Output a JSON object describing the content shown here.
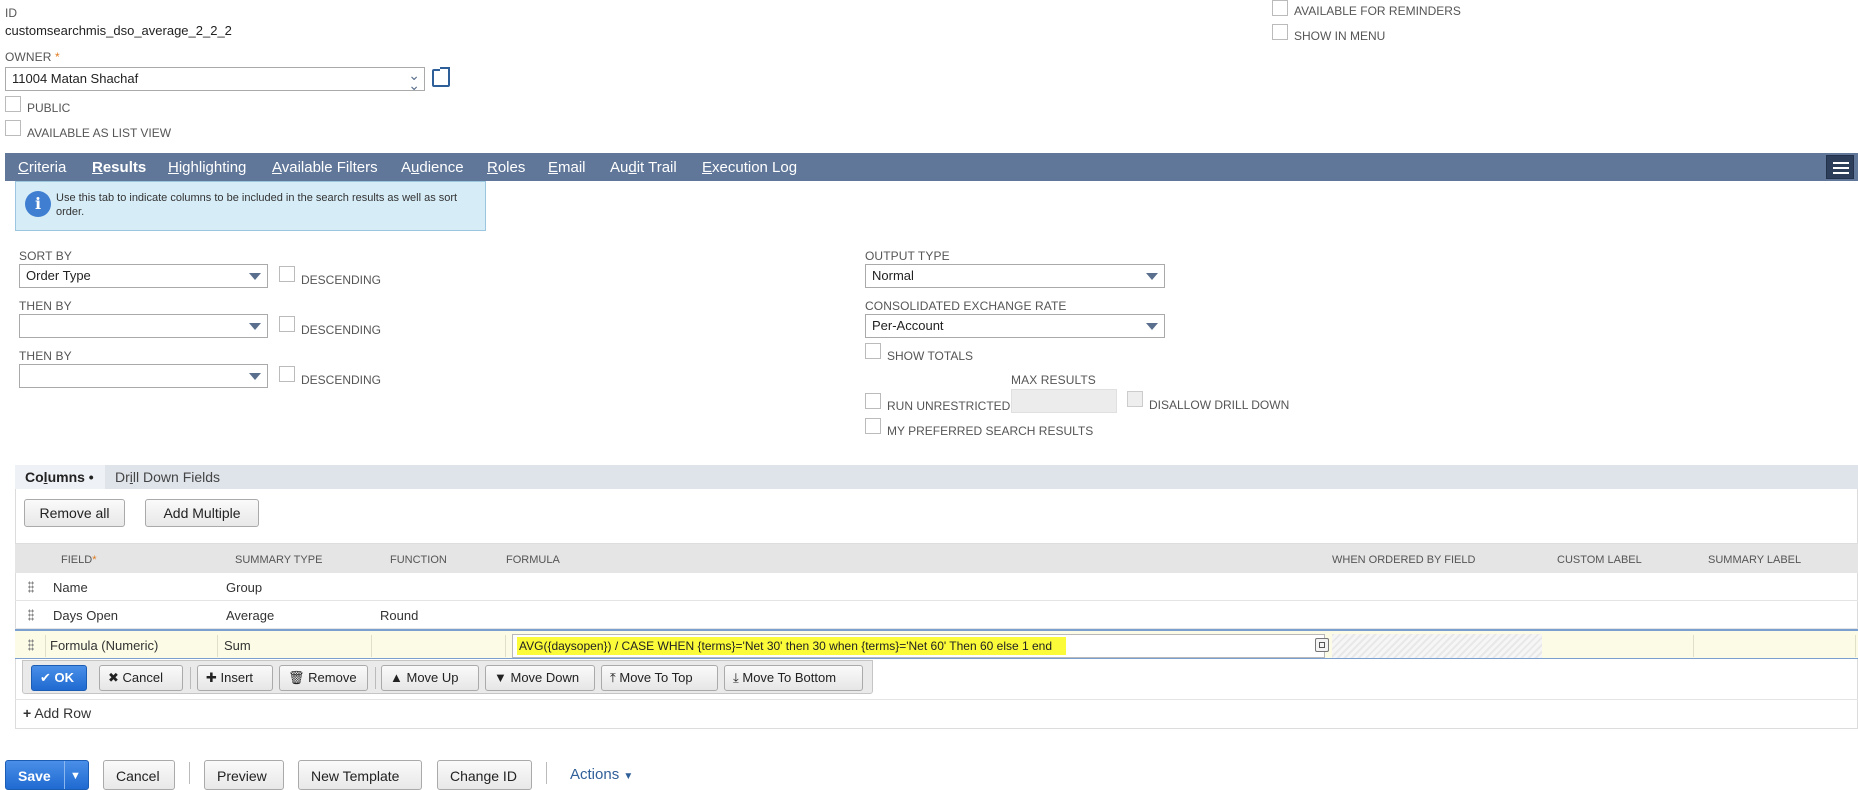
{
  "header": {
    "id_label": "ID",
    "id_value": "customsearchmis_dso_average_2_2_2",
    "owner_label": "OWNER",
    "owner_required": "*",
    "owner_value": "11004 Matan  Shachaf",
    "public_label": "PUBLIC",
    "available_as_list_view_label": "AVAILABLE AS LIST VIEW",
    "available_for_reminders_label": "AVAILABLE FOR REMINDERS",
    "show_in_menu_label": "SHOW IN MENU"
  },
  "tabs": [
    {
      "pre": "",
      "u": "C",
      "post": "riteria"
    },
    {
      "pre": "",
      "u": "R",
      "post": "esults"
    },
    {
      "pre": "",
      "u": "H",
      "post": "ighlighting"
    },
    {
      "pre": "",
      "u": "A",
      "post": "vailable Filters"
    },
    {
      "pre": "A",
      "u": "u",
      "post": "dience"
    },
    {
      "pre": "",
      "u": "R",
      "post": "oles"
    },
    {
      "pre": "",
      "u": "E",
      "post": "mail"
    },
    {
      "pre": "Au",
      "u": "d",
      "post": "it Trail"
    },
    {
      "pre": "",
      "u": "E",
      "post": "xecution Log"
    }
  ],
  "info_text": "Use this tab to indicate columns to be included in the search results as well as sort order.",
  "sort": {
    "sort_by_label": "SORT BY",
    "sort_by_value": "Order Type",
    "then_by_label_1": "THEN BY",
    "then_by_value_1": "",
    "then_by_label_2": "THEN BY",
    "then_by_value_2": "",
    "descending_label": "DESCENDING"
  },
  "output": {
    "output_type_label": "OUTPUT TYPE",
    "output_type_value": "Normal",
    "exchange_rate_label": "CONSOLIDATED EXCHANGE RATE",
    "exchange_rate_value": "Per-Account",
    "show_totals_label": "SHOW TOTALS",
    "run_unrestricted_label": "RUN UNRESTRICTED",
    "max_results_label": "MAX RESULTS",
    "disallow_drill_down_label": "DISALLOW DRILL DOWN",
    "my_preferred_label": "MY PREFERRED SEARCH RESULTS"
  },
  "subtabs": {
    "columns_pre": "Co",
    "columns_u": "l",
    "columns_post": "umns •",
    "drill_pre": "Dr",
    "drill_u": "i",
    "drill_post": "ll Down Fields"
  },
  "list_buttons": {
    "remove_all": "Remove all",
    "add_multiple": "Add Multiple"
  },
  "grid": {
    "headers": {
      "field": "FIELD",
      "summary_type": "SUMMARY TYPE",
      "function": "FUNCTION",
      "formula": "FORMULA",
      "when_ordered": "WHEN ORDERED BY FIELD",
      "custom_label": "CUSTOM LABEL",
      "summary_label": "SUMMARY LABEL"
    },
    "rows": [
      {
        "field": "Name",
        "summary_type": "Group",
        "function": ""
      },
      {
        "field": "Days Open",
        "summary_type": "Average",
        "function": "Round"
      }
    ],
    "edit_row": {
      "field": "Formula (Numeric)",
      "summary_type": "Sum",
      "function": "",
      "formula": "AVG({daysopen}) / CASE WHEN {terms}='Net 30' then 30 when {terms}='Net 60' Then 60 else 1 end"
    }
  },
  "row_actions": {
    "ok": "OK",
    "cancel": "Cancel",
    "insert": "Insert",
    "remove": "Remove",
    "move_up": "Move Up",
    "move_down": "Move Down",
    "move_to_top": "Move To Top",
    "move_to_bottom": "Move To Bottom"
  },
  "add_row": "Add Row",
  "footer": {
    "save": "Save",
    "cancel": "Cancel",
    "preview": "Preview",
    "new_template": "New Template",
    "change_id": "Change ID",
    "actions": "Actions"
  },
  "colors": {
    "tab_bar": "#607799",
    "primary": "#1f6ad1",
    "highlight": "#fbfb3a"
  }
}
